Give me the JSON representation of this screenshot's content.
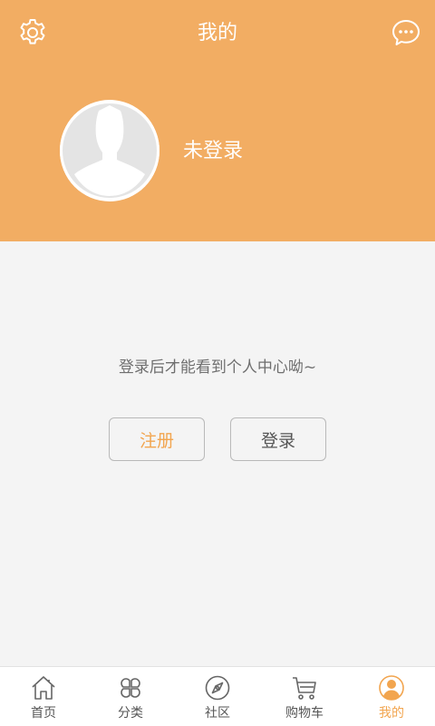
{
  "header": {
    "title": "我的",
    "settings_icon": "gear-icon",
    "message_icon": "chat-bubble-icon"
  },
  "profile": {
    "avatar_icon": "default-user-avatar",
    "username": "未登录"
  },
  "main": {
    "hint": "登录后才能看到个人中心呦~",
    "register_label": "注册",
    "login_label": "登录"
  },
  "tabbar": {
    "tabs": [
      {
        "label": "首页",
        "icon": "home-icon",
        "active": false
      },
      {
        "label": "分类",
        "icon": "category-icon",
        "active": false
      },
      {
        "label": "社区",
        "icon": "compass-icon",
        "active": false
      },
      {
        "label": "购物车",
        "icon": "cart-icon",
        "active": false
      },
      {
        "label": "我的",
        "icon": "user-icon",
        "active": true
      }
    ]
  },
  "colors": {
    "brand": "#f2ad63",
    "accent_text": "#f2a54f",
    "background": "#f4f4f4"
  }
}
